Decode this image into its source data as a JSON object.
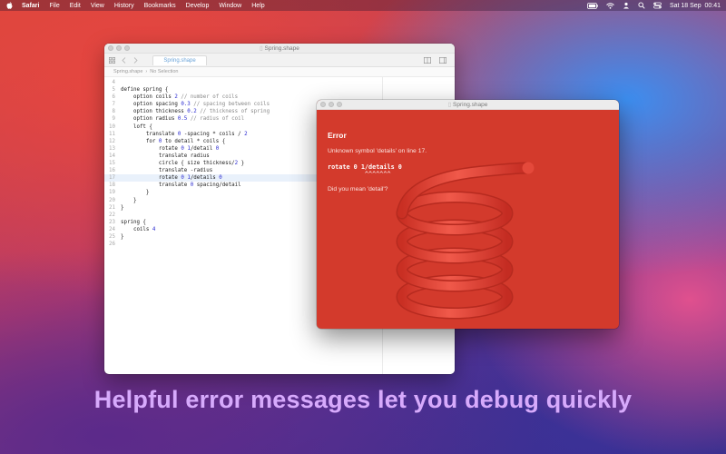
{
  "menubar": {
    "app_name": "Safari",
    "items": [
      "File",
      "Edit",
      "View",
      "History",
      "Bookmarks",
      "Develop",
      "Window",
      "Help"
    ],
    "clock": "Sat 18 Sep  00:41"
  },
  "editor": {
    "window_title": "Spring.shape",
    "tab_label": "Spring.shape",
    "breadcrumb": [
      "Spring.shape",
      "No Selection"
    ],
    "highlight_line": 17,
    "lines": [
      {
        "n": "4",
        "code": ""
      },
      {
        "n": "5",
        "code": "define spring {"
      },
      {
        "n": "6",
        "code": "    option coils 2 // number of coils"
      },
      {
        "n": "7",
        "code": "    option spacing 0.3 // spacing between coils"
      },
      {
        "n": "8",
        "code": "    option thickness 0.2 // thickness of spring"
      },
      {
        "n": "9",
        "code": "    option radius 0.5 // radius of coil"
      },
      {
        "n": "10",
        "code": "    loft {"
      },
      {
        "n": "11",
        "code": "        translate 0 -spacing * coils / 2"
      },
      {
        "n": "12",
        "code": "        for 0 to detail * coils {"
      },
      {
        "n": "13",
        "code": "            rotate 0 1/detail 0"
      },
      {
        "n": "14",
        "code": "            translate radius"
      },
      {
        "n": "15",
        "code": "            circle { size thickness/2 }"
      },
      {
        "n": "16",
        "code": "            translate -radius"
      },
      {
        "n": "17",
        "code": "            rotate 0 1/details 0"
      },
      {
        "n": "18",
        "code": "            translate 0 spacing/detail"
      },
      {
        "n": "19",
        "code": "        }"
      },
      {
        "n": "20",
        "code": "    }"
      },
      {
        "n": "21",
        "code": "}"
      },
      {
        "n": "22",
        "code": ""
      },
      {
        "n": "23",
        "code": "spring {"
      },
      {
        "n": "24",
        "code": "    coils 4"
      },
      {
        "n": "25",
        "code": "}"
      },
      {
        "n": "26",
        "code": ""
      }
    ]
  },
  "error_window": {
    "window_title": "Spring.shape",
    "heading": "Error",
    "message": "Unknown symbol 'details' on line 17.",
    "code_line": "rotate 0 1/details 0",
    "caret_line": "          ^^^^^^^",
    "suggestion": "Did you mean 'detail'?",
    "background_color": "#d33a2c"
  },
  "caption": "Helpful error messages let you debug quickly",
  "colors": {
    "caption": "#d7aafc",
    "number": "#2a2ad0",
    "comment": "#8a8a8a",
    "highlight": "#e9f1fb"
  }
}
